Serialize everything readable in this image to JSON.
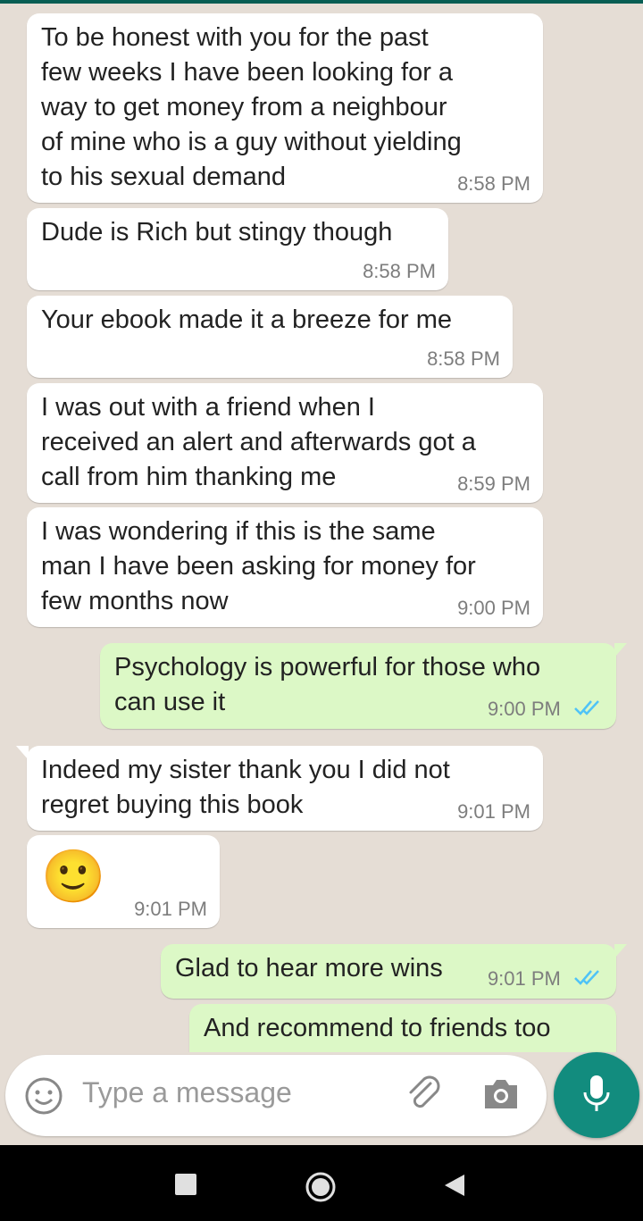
{
  "messages": [
    {
      "text": "To be honest with you for the past\nfew weeks I have been looking for a\nway to get money from a neighbour\nof mine who is a guy without yielding\nto his sexual demand",
      "time": "8:58 PM",
      "direction": "incoming"
    },
    {
      "text": "Dude is Rich but stingy though",
      "time": "8:58 PM",
      "direction": "incoming"
    },
    {
      "text": "Your ebook made it a breeze for me",
      "time": "8:58 PM",
      "direction": "incoming"
    },
    {
      "text": "I was out with a friend when I\nreceived an alert and afterwards got a\ncall from him thanking me",
      "time": "8:59 PM",
      "direction": "incoming"
    },
    {
      "text": "I was wondering if this is the same\nman I have been asking for money for\nfew months now",
      "time": "9:00 PM",
      "direction": "incoming"
    },
    {
      "text": "Psychology is powerful for those who\ncan use it",
      "time": "9:00 PM",
      "direction": "outgoing",
      "status": "read"
    },
    {
      "text": "Indeed my sister thank you I did not\nregret buying this book",
      "time": "9:01 PM",
      "direction": "incoming"
    },
    {
      "text": "🙂",
      "time": "9:01 PM",
      "direction": "incoming",
      "kind": "emoji"
    },
    {
      "text": "Glad to hear more wins",
      "time": "9:01 PM",
      "direction": "outgoing",
      "status": "read"
    },
    {
      "text": "And recommend to friends too",
      "time": "",
      "direction": "outgoing"
    }
  ],
  "composer": {
    "placeholder": "Type a message",
    "emoji_icon": "emoji-icon",
    "attach_icon": "paperclip-icon",
    "camera_icon": "camera-icon",
    "mic_icon": "mic-icon"
  },
  "navbar": {
    "icons": [
      "recent-apps-icon",
      "home-icon",
      "back-icon"
    ]
  },
  "colors": {
    "incoming": "#ffffff",
    "outgoing": "#dcf8c6",
    "accent": "#128c7e",
    "read_tick": "#4fc3f7",
    "wallpaper": "#e5ddd5"
  }
}
